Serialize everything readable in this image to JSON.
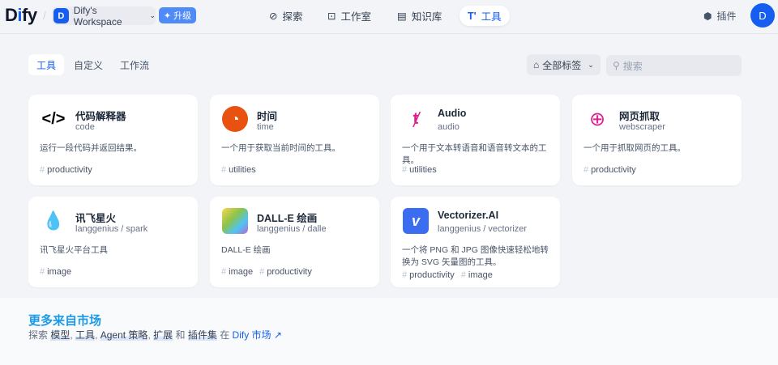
{
  "header": {
    "logo_d": "D",
    "logo_i": "i",
    "logo_rest": "fy",
    "workspace_initial": "D",
    "workspace": "Dify's Workspace",
    "upgrade": "升级",
    "nav": [
      {
        "label": "探索"
      },
      {
        "label": "工作室"
      },
      {
        "label": "知识库"
      },
      {
        "label": "工具"
      }
    ],
    "plugins": "插件",
    "user_initial": "D"
  },
  "tabs": [
    {
      "label": "工具"
    },
    {
      "label": "自定义"
    },
    {
      "label": "工作流"
    }
  ],
  "filter": {
    "tags": "全部标签",
    "search_placeholder": "搜索"
  },
  "cards": [
    {
      "name": "代码解释器",
      "sub": "code",
      "desc": "运行一段代码并返回结果。",
      "tags": [
        "productivity"
      ]
    },
    {
      "name": "时间",
      "sub": "time",
      "desc": "一个用于获取当前时间的工具。",
      "tags": [
        "utilities"
      ]
    },
    {
      "name": "Audio",
      "sub": "audio",
      "desc": "一个用于文本转语音和语音转文本的工具。",
      "tags": [
        "utilities"
      ]
    },
    {
      "name": "网页抓取",
      "sub": "webscraper",
      "desc": "一个用于抓取网页的工具。",
      "tags": [
        "productivity"
      ]
    },
    {
      "name": "讯飞星火",
      "sub": "langgenius / spark",
      "desc": "讯飞星火平台工具",
      "tags": [
        "image"
      ]
    },
    {
      "name": "DALL-E 绘画",
      "sub": "langgenius / dalle",
      "desc": "DALL-E 绘画",
      "tags": [
        "image",
        "productivity"
      ]
    },
    {
      "name": "Vectorizer.AI",
      "sub": "langgenius / vectorizer",
      "desc": "一个将 PNG 和 JPG 图像快速轻松地转换为 SVG 矢量图的工具。",
      "tags": [
        "productivity",
        "image"
      ]
    }
  ],
  "market": {
    "title": "更多来自市场",
    "p1": "探索",
    "k1": "模型",
    "k2": "工具",
    "k3": "Agent 策略",
    "k4": "扩展",
    "and": "和",
    "k5": "插件集",
    "at": "在",
    "link": "Dify 市场 ↗"
  }
}
